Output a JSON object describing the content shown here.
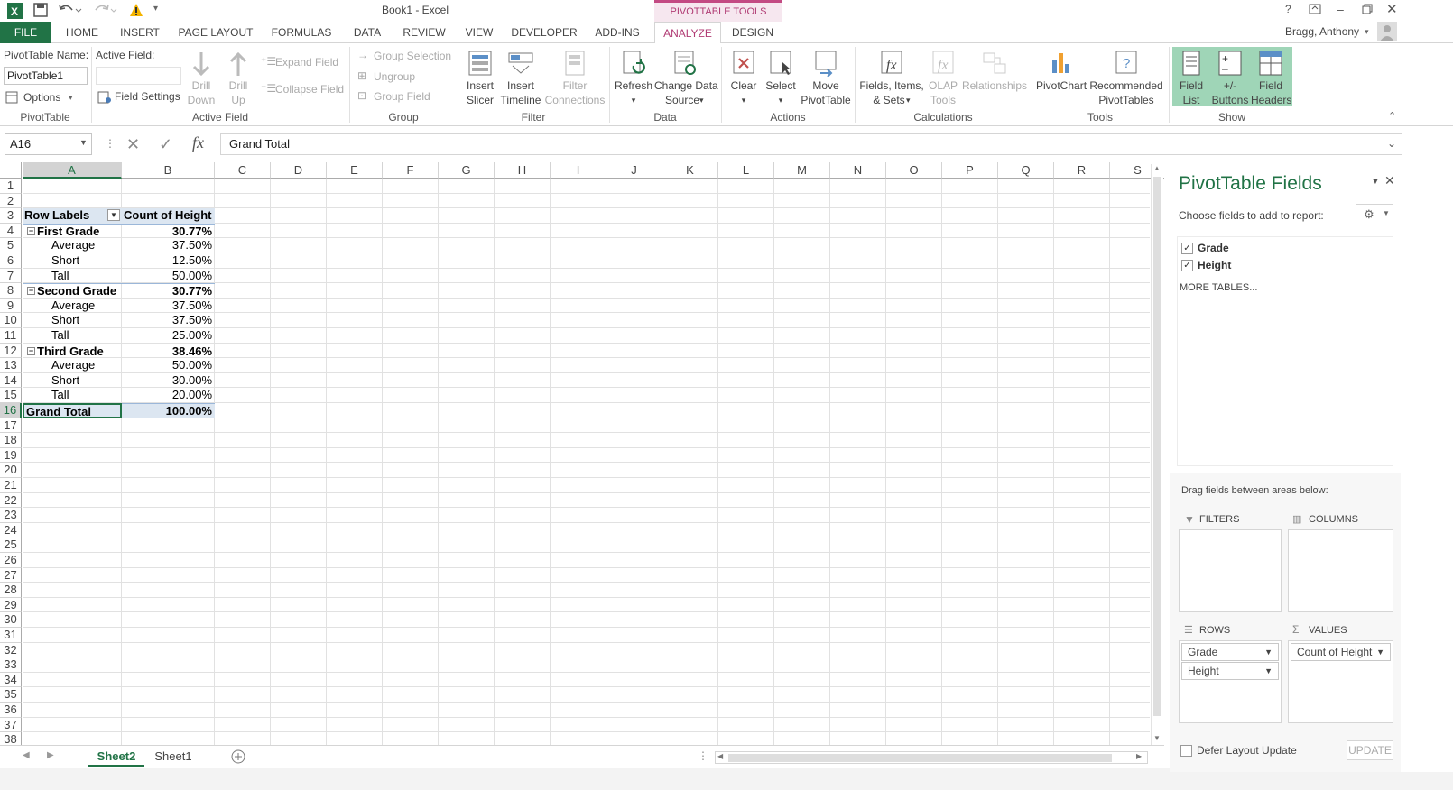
{
  "window": {
    "title": "Book1 - Excel",
    "context_group": "PIVOTTABLE TOOLS",
    "user": "Bragg, Anthony"
  },
  "tabs": [
    "FILE",
    "HOME",
    "INSERT",
    "PAGE LAYOUT",
    "FORMULAS",
    "DATA",
    "REVIEW",
    "VIEW",
    "DEVELOPER",
    "ADD-INS",
    "ANALYZE",
    "DESIGN"
  ],
  "ribbon": {
    "pivottable": {
      "name_label": "PivotTable Name:",
      "name_value": "PivotTable1",
      "options": "Options",
      "group": "PivotTable"
    },
    "active_field": {
      "label": "Active Field:",
      "value": "",
      "settings": "Field Settings",
      "drill_down_1": "Drill",
      "drill_down_2": "Down",
      "drill_up_1": "Drill",
      "drill_up_2": "Up",
      "expand": "Expand Field",
      "collapse": "Collapse Field",
      "group": "Active Field"
    },
    "group": {
      "selection": "Group Selection",
      "ungroup": "Ungroup",
      "field": "Group Field",
      "group": "Group"
    },
    "filter": {
      "slicer_1": "Insert",
      "slicer_2": "Slicer",
      "timeline_1": "Insert",
      "timeline_2": "Timeline",
      "conn_1": "Filter",
      "conn_2": "Connections",
      "group": "Filter"
    },
    "data": {
      "refresh": "Refresh",
      "change_1": "Change Data",
      "change_2": "Source",
      "group": "Data"
    },
    "actions": {
      "clear": "Clear",
      "select": "Select",
      "move_1": "Move",
      "move_2": "PivotTable",
      "group": "Actions"
    },
    "calc": {
      "fields_1": "Fields, Items,",
      "fields_2": "& Sets",
      "olap_1": "OLAP",
      "olap_2": "Tools",
      "rel": "Relationships",
      "group": "Calculations"
    },
    "tools": {
      "pivotchart": "PivotChart",
      "rec_1": "Recommended",
      "rec_2": "PivotTables",
      "group": "Tools"
    },
    "show": {
      "fl_1": "Field",
      "fl_2": "List",
      "pm_1": "+/-",
      "pm_2": "Buttons",
      "fh_1": "Field",
      "fh_2": "Headers",
      "group": "Show"
    }
  },
  "formula_bar": {
    "name_box": "A16",
    "fx": "fx",
    "formula": "Grand Total"
  },
  "columns": [
    "A",
    "B",
    "C",
    "D",
    "E",
    "F",
    "G",
    "H",
    "I",
    "J",
    "K",
    "L",
    "M",
    "N",
    "O",
    "P",
    "Q",
    "R",
    "S"
  ],
  "rows": [
    "1",
    "2",
    "3",
    "4",
    "5",
    "6",
    "7",
    "8",
    "9",
    "10",
    "11",
    "12",
    "13",
    "14",
    "15",
    "16",
    "17",
    "18",
    "19",
    "20",
    "21",
    "22",
    "23",
    "24",
    "25",
    "26",
    "27",
    "28",
    "29",
    "30",
    "31",
    "32",
    "33",
    "34",
    "35",
    "36",
    "37",
    "38"
  ],
  "pivot": {
    "header": {
      "a": "Row Labels",
      "b": "Count of Height"
    },
    "lines": [
      {
        "a": "First Grade",
        "b": "30.77%",
        "level": 0
      },
      {
        "a": "Average",
        "b": "37.50%",
        "level": 1
      },
      {
        "a": "Short",
        "b": "12.50%",
        "level": 1
      },
      {
        "a": "Tall",
        "b": "50.00%",
        "level": 1
      },
      {
        "a": "Second Grade",
        "b": "30.77%",
        "level": 0
      },
      {
        "a": "Average",
        "b": "37.50%",
        "level": 1
      },
      {
        "a": "Short",
        "b": "37.50%",
        "level": 1
      },
      {
        "a": "Tall",
        "b": "25.00%",
        "level": 1
      },
      {
        "a": "Third Grade",
        "b": "38.46%",
        "level": 0
      },
      {
        "a": "Average",
        "b": "50.00%",
        "level": 1
      },
      {
        "a": "Short",
        "b": "30.00%",
        "level": 1
      },
      {
        "a": "Tall",
        "b": "20.00%",
        "level": 1
      }
    ],
    "total": {
      "a": "Grand Total",
      "b": "100.00%"
    }
  },
  "sheets": {
    "active": "Sheet2",
    "other": "Sheet1"
  },
  "panel": {
    "title": "PivotTable Fields",
    "choose": "Choose fields to add to report:",
    "fields": [
      {
        "name": "Grade",
        "checked": true
      },
      {
        "name": "Height",
        "checked": true
      }
    ],
    "more": "MORE TABLES...",
    "drag": "Drag fields between areas below:",
    "filters": "FILTERS",
    "columns": "COLUMNS",
    "rows": "ROWS",
    "values": "VALUES",
    "row_fields": [
      "Grade",
      "Height"
    ],
    "value_fields": [
      "Count of Height"
    ],
    "defer": "Defer Layout Update",
    "update": "UPDATE"
  },
  "colors": {
    "excel_green": "#217346",
    "accent_pink": "#a4373a",
    "pivot_tools": "#c0504d",
    "show_bg": "#9fd5b7",
    "selected_header": "#d3d3d3"
  }
}
